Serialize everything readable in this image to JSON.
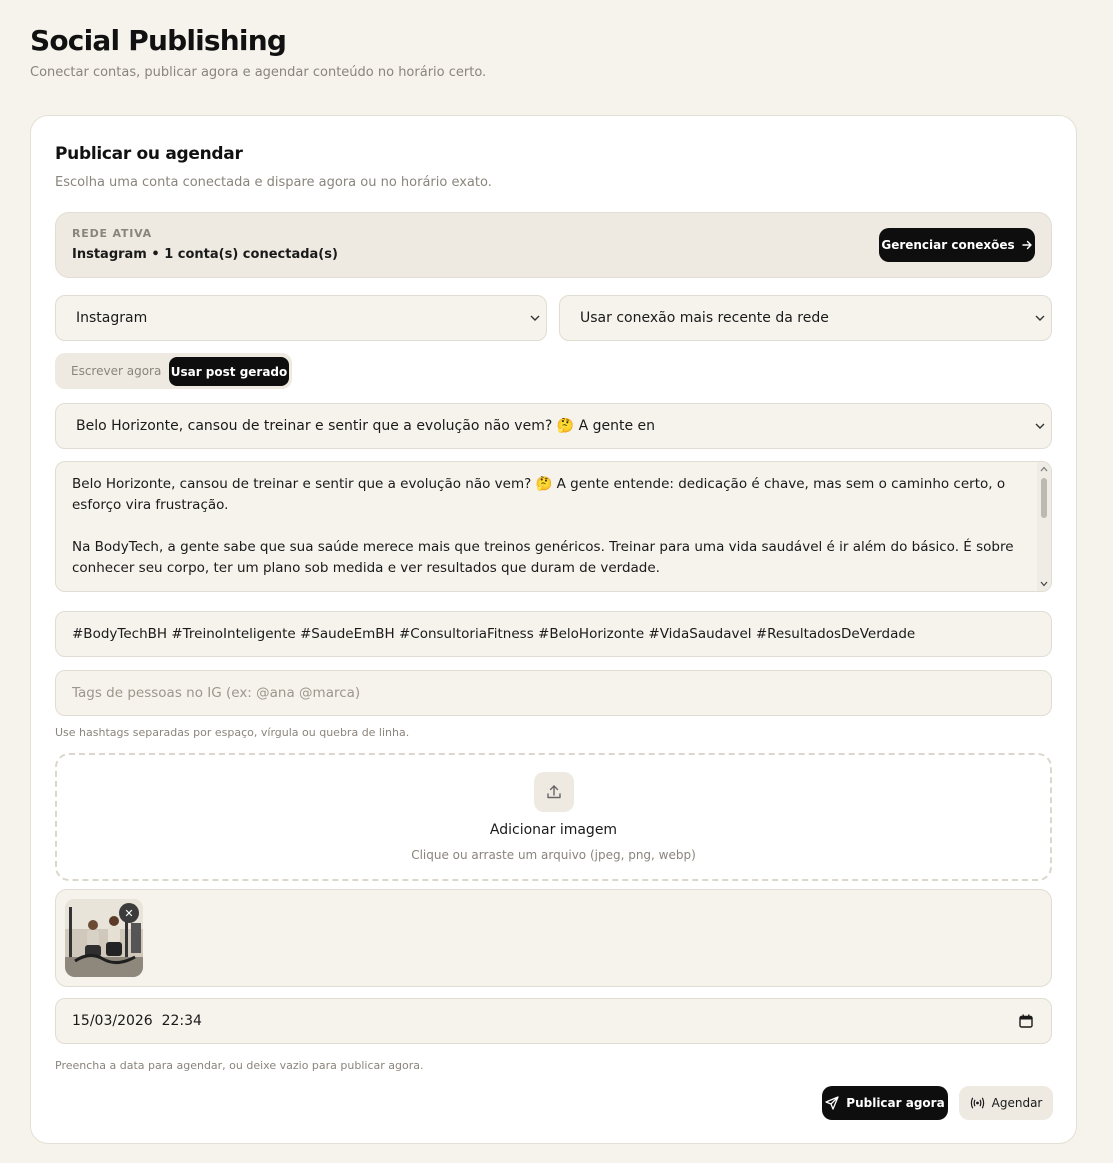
{
  "page": {
    "title": "Social Publishing",
    "subtitle": "Conectar contas, publicar agora e agendar conteúdo no horário certo."
  },
  "card": {
    "title": "Publicar ou agendar",
    "subtitle": "Escolha uma conta conectada e dispare agora ou no horário exato."
  },
  "active_network": {
    "label": "REDE ATIVA",
    "value": "Instagram • 1 conta(s) conectada(s)",
    "manage_button": "Gerenciar conexões"
  },
  "network_select": {
    "value": "Instagram"
  },
  "connection_select": {
    "value": "Usar conexão mais recente da rede"
  },
  "mode_toggle": {
    "options": [
      "Escrever agora",
      "Usar post gerado"
    ],
    "selected": "Usar post gerado"
  },
  "generated_post_select": {
    "value": "Belo Horizonte, cansou de treinar e sentir que a evolução não vem? 🤔 A gente en"
  },
  "caption": {
    "paragraph_1": "Belo Horizonte, cansou de treinar e sentir que a evolução não vem? 🤔 A gente entende: dedicação é chave, mas sem o caminho certo, o esforço vira frustração.",
    "paragraph_2": "Na BodyTech, a gente sabe que sua saúde merece mais que treinos genéricos. Treinar para uma vida saudável é ir além do básico. É sobre conhecer seu corpo, ter um plano sob medida e ver resultados que duram de verdade."
  },
  "hashtags": {
    "value": "#BodyTechBH #TreinoInteligente #SaudeEmBH #ConsultoriaFitness #BeloHorizonte #VidaSaudavel #ResultadosDeVerdade"
  },
  "people_tags": {
    "placeholder": "Tags de pessoas no IG (ex: @ana @marca)"
  },
  "hashtags_hint": "Use hashtags separadas por espaço, vírgula ou quebra de linha.",
  "upload": {
    "title": "Adicionar imagem",
    "subtitle": "Clique ou arraste um arquivo (jpeg, png, webp)"
  },
  "schedule": {
    "value": "15/03/2026  22:34",
    "hint": "Preencha a data para agendar, ou deixe vazio para publicar agora."
  },
  "actions": {
    "publish": "Publicar agora",
    "schedule": "Agendar"
  },
  "icons": [
    "arrow-right-icon",
    "chevron-down-icon",
    "upload-icon",
    "close-icon",
    "calendar-icon",
    "send-icon",
    "broadcast-icon"
  ]
}
